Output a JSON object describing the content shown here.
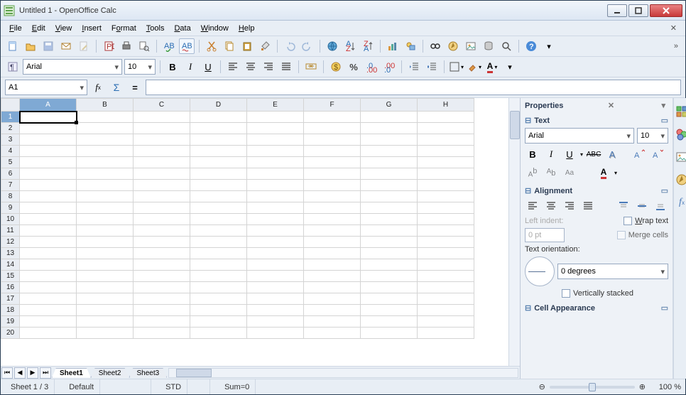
{
  "window": {
    "title": "Untitled 1 - OpenOffice Calc"
  },
  "menu": {
    "file": "File",
    "edit": "Edit",
    "view": "View",
    "insert": "Insert",
    "format": "Format",
    "tools": "Tools",
    "data": "Data",
    "window": "Window",
    "help": "Help"
  },
  "format_toolbar": {
    "font": "Arial",
    "size": "10"
  },
  "refbar": {
    "cell": "A1",
    "formula": ""
  },
  "columns": [
    "A",
    "B",
    "C",
    "D",
    "E",
    "F",
    "G",
    "H"
  ],
  "rows": [
    "1",
    "2",
    "3",
    "4",
    "5",
    "6",
    "7",
    "8",
    "9",
    "10",
    "11",
    "12",
    "13",
    "14",
    "15",
    "16",
    "17",
    "18",
    "19",
    "20"
  ],
  "active": {
    "col": 0,
    "row": 0
  },
  "tabs": {
    "items": [
      "Sheet1",
      "Sheet2",
      "Sheet3"
    ],
    "active": 0
  },
  "sidebar": {
    "title": "Properties",
    "text": {
      "title": "Text",
      "font": "Arial",
      "size": "10"
    },
    "alignment": {
      "title": "Alignment",
      "indent_label": "Left indent:",
      "indent_value": "0 pt",
      "wrap_label": "Wrap text",
      "merge_label": "Merge cells",
      "orient_label": "Text orientation:",
      "orient_value": "0 degrees",
      "vstack_label": "Vertically stacked"
    },
    "cell_appearance": {
      "title": "Cell Appearance"
    }
  },
  "status": {
    "sheet": "Sheet 1 / 3",
    "style": "Default",
    "mode": "STD",
    "sum": "Sum=0",
    "zoom": "100 %"
  }
}
